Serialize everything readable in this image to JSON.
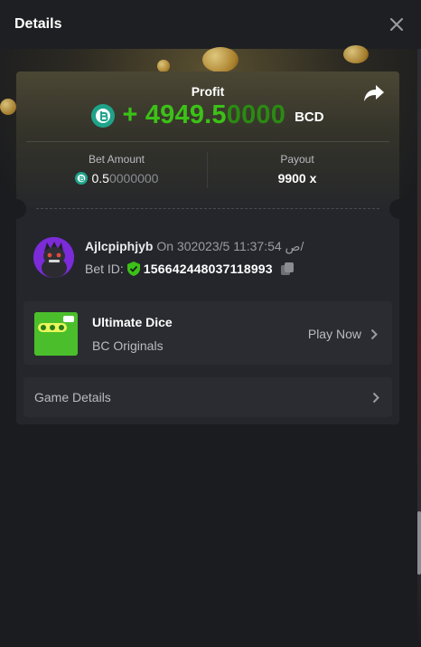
{
  "header": {
    "title": "Details"
  },
  "profit": {
    "label": "Profit",
    "sign_prefix": "+ 4949.5",
    "value_trailing": "0000",
    "currency": "BCD"
  },
  "bet_amount": {
    "label": "Bet Amount",
    "value_main": "0.5",
    "value_trailing": "0000000"
  },
  "payout": {
    "label": "Payout",
    "value": "9900 x"
  },
  "user": {
    "name": "Ajlcpiphjyb",
    "datetime": "On 30ص 11:37:54 2023/5/",
    "bet_id_label": "Bet ID:",
    "bet_id": "156642448037118993"
  },
  "game": {
    "name": "Ultimate Dice",
    "provider": "BC Originals",
    "thumb_text": "ULTIMATE DICE",
    "play_label": "Play Now"
  },
  "game_details": {
    "label": "Game Details"
  },
  "colors": {
    "accent_green": "#3bc117",
    "brand_bc": "#1fa38a"
  }
}
